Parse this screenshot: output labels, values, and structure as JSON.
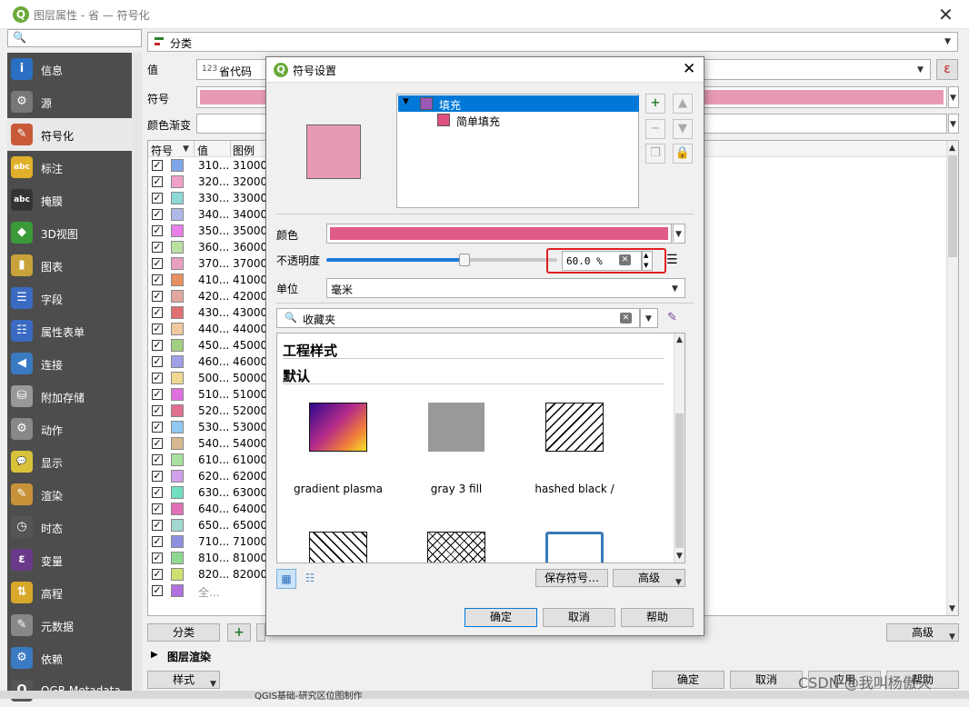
{
  "window": {
    "title": "图层属性 - 省 — 符号化",
    "q_logo": "Q"
  },
  "search": {
    "placeholder": ""
  },
  "sidebar": {
    "items": [
      {
        "label": "信息",
        "icon": "info-icon",
        "glyph": "i",
        "color": "#2a6fc2"
      },
      {
        "label": "源",
        "icon": "source-icon",
        "glyph": "⚙",
        "color": "#777777"
      },
      {
        "label": "符号化",
        "icon": "symbology-icon",
        "glyph": "✎",
        "color": "#c85a3a"
      },
      {
        "label": "标注",
        "icon": "labels-icon",
        "glyph": "abc",
        "color": "#e0b02a"
      },
      {
        "label": "掩膜",
        "icon": "mask-icon",
        "glyph": "abc",
        "color": "#333333"
      },
      {
        "label": "3D视图",
        "icon": "3d-icon",
        "glyph": "◆",
        "color": "#3a9a3a"
      },
      {
        "label": "图表",
        "icon": "diagram-icon",
        "glyph": "▮",
        "color": "#c8a23a"
      },
      {
        "label": "字段",
        "icon": "fields-icon",
        "glyph": "☰",
        "color": "#3a6ac2"
      },
      {
        "label": "属性表单",
        "icon": "attribute-form-icon",
        "glyph": "☷",
        "color": "#3a6ac2"
      },
      {
        "label": "连接",
        "icon": "joins-icon",
        "glyph": "◀",
        "color": "#3a7ac2"
      },
      {
        "label": "附加存储",
        "icon": "auxiliary-storage-icon",
        "glyph": "⛁",
        "color": "#999999"
      },
      {
        "label": "动作",
        "icon": "actions-icon",
        "glyph": "⚙",
        "color": "#888888"
      },
      {
        "label": "显示",
        "icon": "display-icon",
        "glyph": "💬",
        "color": "#d8c23a"
      },
      {
        "label": "渲染",
        "icon": "rendering-icon",
        "glyph": "✎",
        "color": "#c8923a"
      },
      {
        "label": "时态",
        "icon": "temporal-icon",
        "glyph": "◷",
        "color": "#555555"
      },
      {
        "label": "变量",
        "icon": "variables-icon",
        "glyph": "ε",
        "color": "#6a3a8a"
      },
      {
        "label": "高程",
        "icon": "elevation-icon",
        "glyph": "⇅",
        "color": "#d8a82a"
      },
      {
        "label": "元数据",
        "icon": "metadata-icon",
        "glyph": "✎",
        "color": "#888888"
      },
      {
        "label": "依赖",
        "icon": "dependencies-icon",
        "glyph": "⚙",
        "color": "#3a7ac2"
      },
      {
        "label": "QGR Metadata",
        "icon": "qgr-metadata-icon",
        "glyph": "Q",
        "color": "#555555"
      }
    ]
  },
  "renderer": {
    "type_label": "分类"
  },
  "value_row": {
    "label": "值",
    "type_badge": "123",
    "value": "省代码",
    "expr_label": "ε"
  },
  "symbol_row": {
    "label": "符号",
    "color": "#e89ab5"
  },
  "ramp_row": {
    "label": "颜色渐变"
  },
  "table": {
    "headers": [
      "符号",
      "值",
      "图例"
    ],
    "rows": [
      {
        "value": "310...",
        "legend": "31000",
        "color": "#7fa6e8"
      },
      {
        "value": "320...",
        "legend": "32000",
        "color": "#f0a0c8"
      },
      {
        "value": "330...",
        "legend": "33000",
        "color": "#8fd8d8"
      },
      {
        "value": "340...",
        "legend": "34000",
        "color": "#b0b8e8"
      },
      {
        "value": "350...",
        "legend": "35000",
        "color": "#e880e8"
      },
      {
        "value": "360...",
        "legend": "36000",
        "color": "#b8e0a0"
      },
      {
        "value": "370...",
        "legend": "37000",
        "color": "#e8a0c0"
      },
      {
        "value": "410...",
        "legend": "41000",
        "color": "#e89060"
      },
      {
        "value": "420...",
        "legend": "42000",
        "color": "#e0a8a0"
      },
      {
        "value": "430...",
        "legend": "43000",
        "color": "#e07070"
      },
      {
        "value": "440...",
        "legend": "44000",
        "color": "#f0c8a0"
      },
      {
        "value": "450...",
        "legend": "45000",
        "color": "#a0d080"
      },
      {
        "value": "460...",
        "legend": "46000",
        "color": "#a0a0e8"
      },
      {
        "value": "500...",
        "legend": "50000",
        "color": "#f0d890"
      },
      {
        "value": "510...",
        "legend": "51000",
        "color": "#e070e0"
      },
      {
        "value": "520...",
        "legend": "52000",
        "color": "#e07090"
      },
      {
        "value": "530...",
        "legend": "53000",
        "color": "#90c8f0"
      },
      {
        "value": "540...",
        "legend": "54000",
        "color": "#d8b890"
      },
      {
        "value": "610...",
        "legend": "61000",
        "color": "#a8e0a0"
      },
      {
        "value": "620...",
        "legend": "62000",
        "color": "#d0a0e8"
      },
      {
        "value": "630...",
        "legend": "63000",
        "color": "#70e0c0"
      },
      {
        "value": "640...",
        "legend": "64000",
        "color": "#e070b8"
      },
      {
        "value": "650...",
        "legend": "65000",
        "color": "#a0d8d0"
      },
      {
        "value": "710...",
        "legend": "71000",
        "color": "#9090e0"
      },
      {
        "value": "810...",
        "legend": "81000",
        "color": "#90d890"
      },
      {
        "value": "820...",
        "legend": "82000",
        "color": "#d0e070"
      },
      {
        "value": "全...",
        "legend": "",
        "color": "#b070e0"
      }
    ]
  },
  "bottom": {
    "classify_label": "分类",
    "advanced_label": "高级",
    "layer_rendering_label": "图层渲染",
    "style_label": "样式",
    "ok_label": "确定",
    "cancel_label": "取消",
    "apply_label": "应用",
    "help_label": "帮助"
  },
  "dialog": {
    "title": "符号设置",
    "tree": {
      "root_label": "填充",
      "child_label": "简单填充",
      "root_color": "#9b59b6",
      "child_color": "#e05080"
    },
    "preview_color": "#e89ab5",
    "color_label": "颜色",
    "color_value": "#e05a8a",
    "opacity_label": "不透明度",
    "opacity_value": "60.0 %",
    "opacity_fraction": 0.6,
    "unit_label": "单位",
    "unit_value": "毫米",
    "favorites_placeholder": "收藏夹",
    "section_project": "工程样式",
    "section_default": "默认",
    "thumbs": [
      {
        "caption": "gradient   plasma"
      },
      {
        "caption": "gray 3 fill"
      },
      {
        "caption": "hashed black /"
      }
    ],
    "save_symbol_label": "保存符号…",
    "advanced_label": "高级",
    "ok_label": "确定",
    "cancel_label": "取消",
    "help_label": "帮助",
    "highlight_color": "#e02020"
  },
  "watermark": "CSDN @我叫杨傲天",
  "taskbar_text": "QGIS基础-研究区位图制作"
}
